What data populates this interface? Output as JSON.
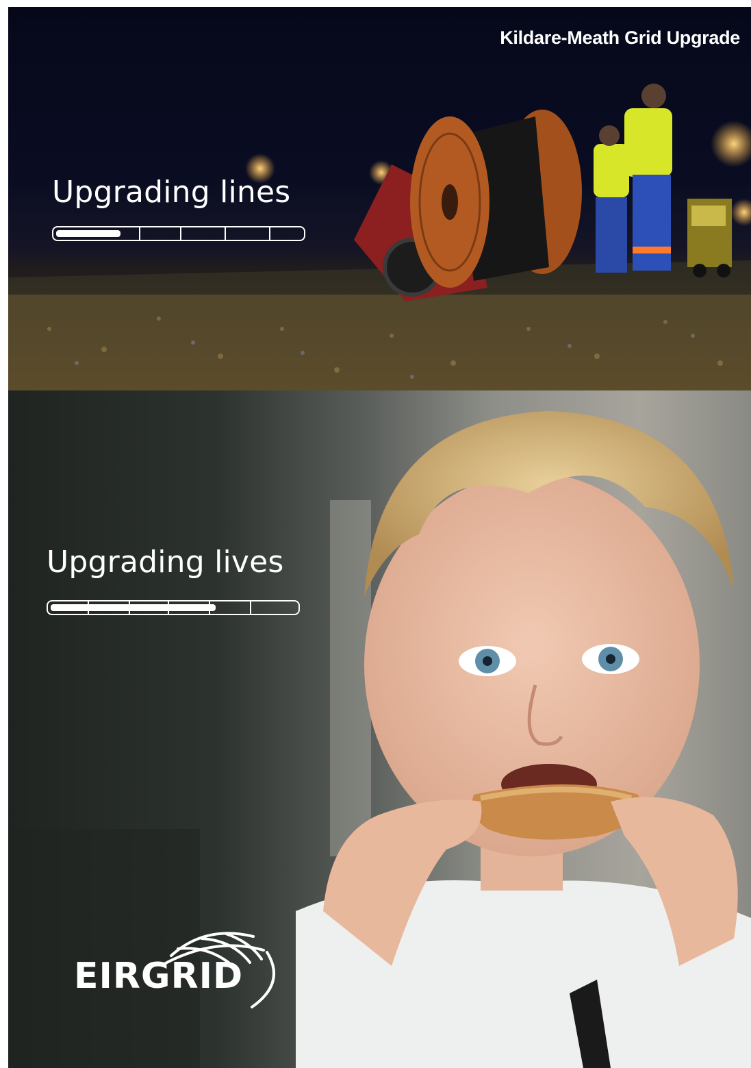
{
  "campaign_title": "Kildare-Meath Grid Upgrade",
  "sections": [
    {
      "headline": "Upgrading lines",
      "progress": 0.28
    },
    {
      "headline": "Upgrading lives",
      "progress": 0.68
    }
  ],
  "brand": {
    "logo_text": "EIRGRID"
  },
  "colors": {
    "text": "#ffffff",
    "night_sky": "#06081a",
    "hi_vis": "#d8e62a",
    "cable_drum": "#b35a22"
  }
}
